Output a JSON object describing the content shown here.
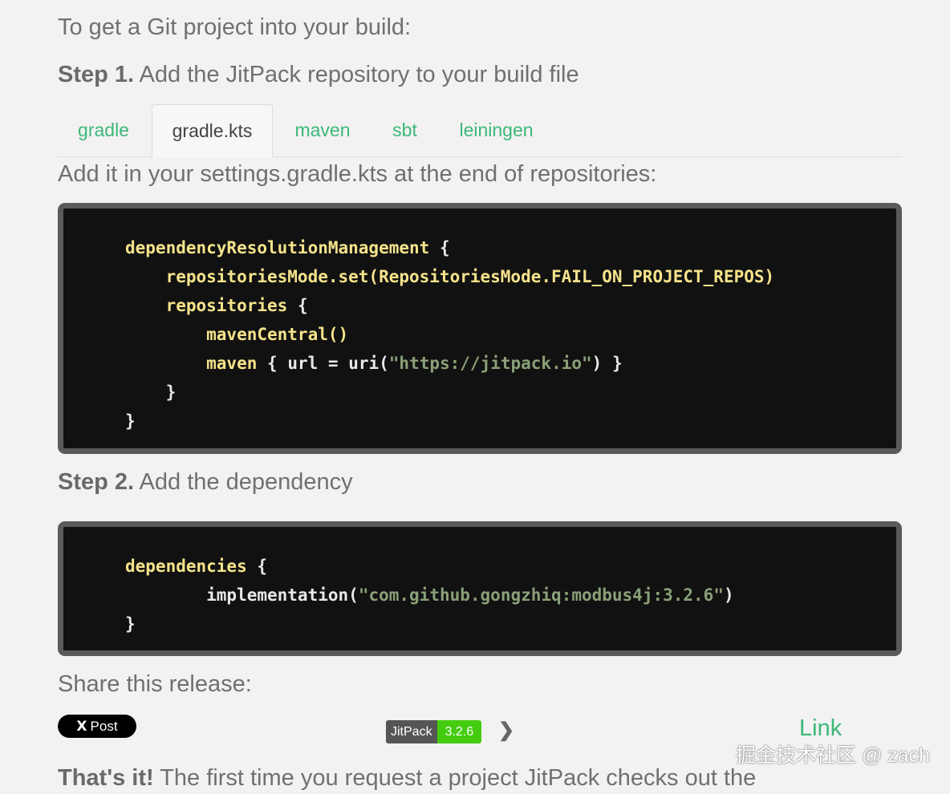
{
  "intro": "To get a Git project into your build:",
  "step1": {
    "label": "Step 1.",
    "text": " Add the JitPack repository to your build file"
  },
  "tabs": [
    {
      "label": "gradle",
      "active": false
    },
    {
      "label": "gradle.kts",
      "active": true
    },
    {
      "label": "maven",
      "active": false
    },
    {
      "label": "sbt",
      "active": false
    },
    {
      "label": "leiningen",
      "active": false
    }
  ],
  "tab_description": "Add it in your settings.gradle.kts at the end of repositories:",
  "code1": {
    "l1": {
      "a": "dependencyResolutionManagement",
      "b": " {"
    },
    "l2": {
      "a": "    repositoriesMode.set(RepositoriesMode.FAIL_ON_PROJECT_REPOS)"
    },
    "l3": {
      "a": "    repositories",
      "b": " {"
    },
    "l4": {
      "a": "        mavenCentral()"
    },
    "l5": {
      "a": "        maven",
      "b": " { ",
      "c": "url",
      "d": " = ",
      "e": "uri",
      "f": "(",
      "g": "\"https://jitpack.io\"",
      "h": ") }"
    },
    "l6": {
      "a": "    }"
    },
    "l7": {
      "a": "}"
    }
  },
  "step2": {
    "label": "Step 2.",
    "text": " Add the dependency"
  },
  "code2": {
    "l1": {
      "a": "dependencies",
      "b": " {"
    },
    "l2": {
      "a": "        implementation",
      "b": "(",
      "c": "\"com.github.gongzhiq:modbus4j:3.2.6\"",
      "d": ")"
    },
    "l3": {
      "a": "}"
    }
  },
  "share_label": "Share this release:",
  "x_post": {
    "icon": "X",
    "label": "Post"
  },
  "badge": {
    "left": "JitPack",
    "right": "3.2.6"
  },
  "link_label": "Link",
  "watermark": "掘金技术社区 @ zach",
  "final": {
    "bold": "That's it!",
    "text": " The first time you request a project JitPack checks out the"
  },
  "colors": {
    "accent": "#3cb878",
    "code_bg": "#111111",
    "badge_green": "#44cc11"
  }
}
